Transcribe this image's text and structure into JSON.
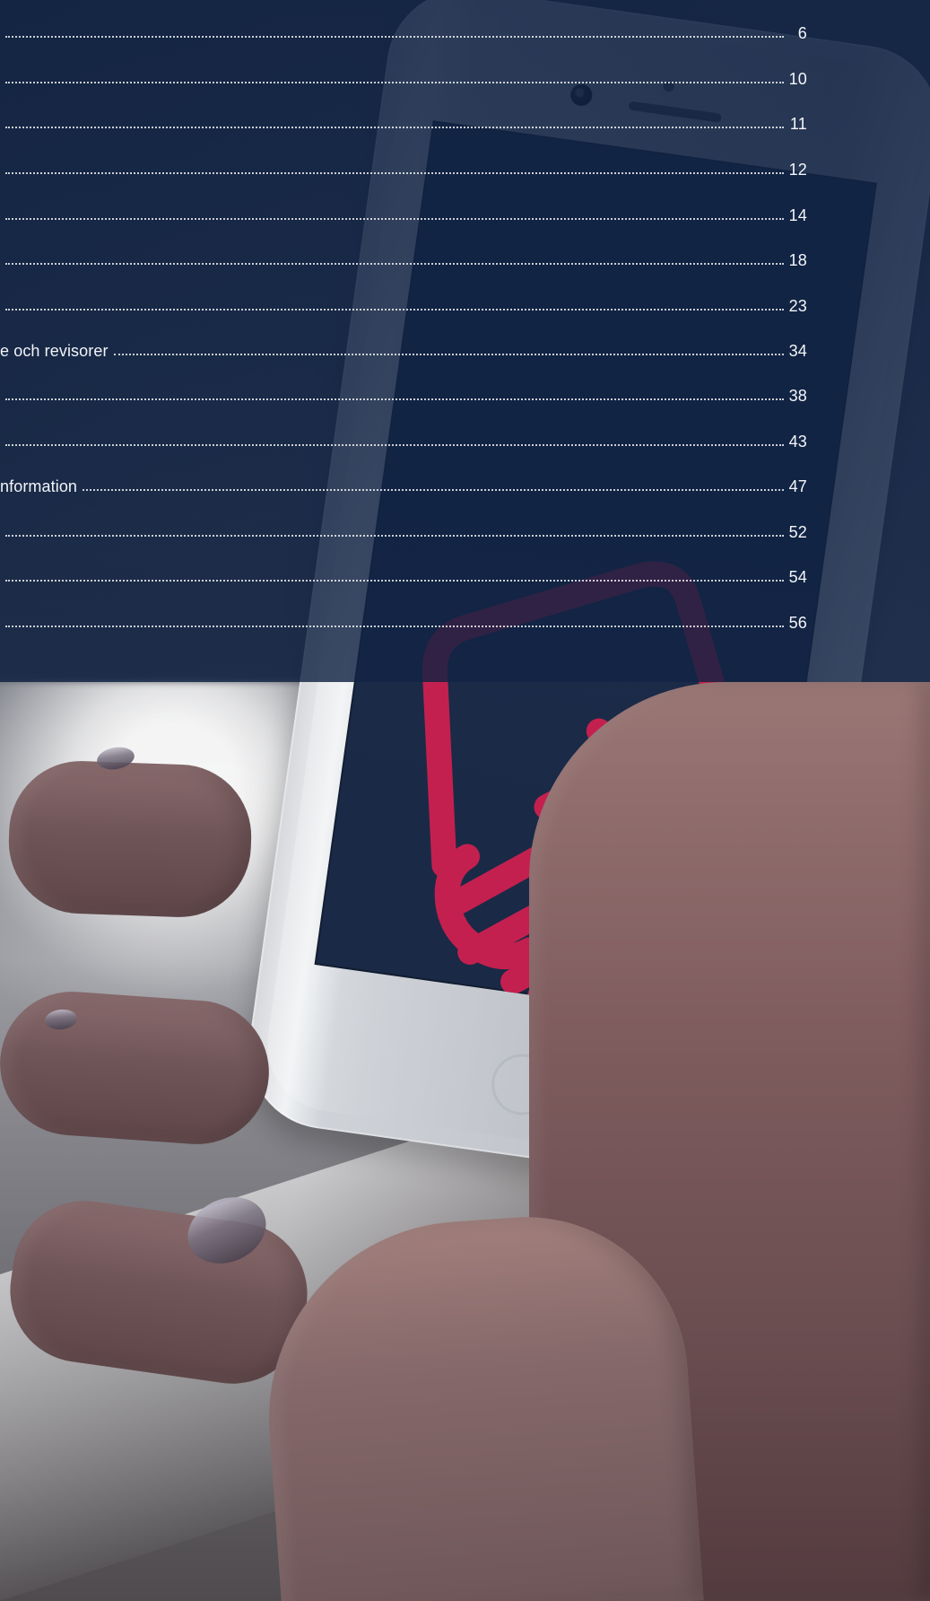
{
  "toc": {
    "entries": [
      {
        "label": "",
        "page": "6"
      },
      {
        "label": "",
        "page": "10"
      },
      {
        "label": "",
        "page": "11"
      },
      {
        "label": "",
        "page": "12"
      },
      {
        "label": "",
        "page": "14"
      },
      {
        "label": "",
        "page": "18"
      },
      {
        "label": "",
        "page": "23"
      },
      {
        "label": "e och revisorer",
        "page": "34"
      },
      {
        "label": "",
        "page": "38"
      },
      {
        "label": "",
        "page": "43"
      },
      {
        "label": "nformation",
        "page": "47"
      },
      {
        "label": "",
        "page": "52"
      },
      {
        "label": "",
        "page": "54"
      },
      {
        "label": "",
        "page": "56"
      }
    ]
  },
  "phone": {
    "screen_color": "#1b2b48",
    "logo_color": "#c4204f"
  },
  "icons": {
    "front_camera": "camera-icon",
    "speaker": "speaker-icon",
    "sensor": "sensor-icon",
    "home_button": "home-button-icon",
    "logo": "hand-logo-icon"
  }
}
